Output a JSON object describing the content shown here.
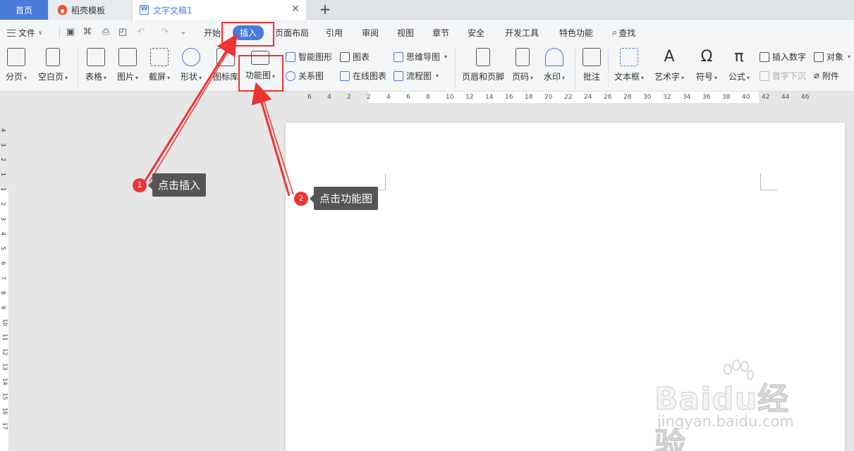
{
  "tabs": {
    "home": "首页",
    "template": "稻壳模板",
    "document": "文字文稿1"
  },
  "menu": {
    "file": "文件",
    "items": [
      "开始",
      "插入",
      "页面布局",
      "引用",
      "审阅",
      "视图",
      "章节",
      "安全",
      "开发工具",
      "特色功能"
    ],
    "active": "插入",
    "search": "查找"
  },
  "ribbon": {
    "page_break": "分页",
    "blank_page": "空白页",
    "table": "表格",
    "picture": "图片",
    "screenshot": "截屏",
    "shape": "形状",
    "icon_library": "图标库",
    "function_chart": "功能图",
    "smart_shape": "智能图形",
    "chart": "图表",
    "mind_map": "思维导图",
    "relation_chart": "关系图",
    "online_chart": "在线图表",
    "flow_chart": "流程图",
    "header_footer": "页眉和页脚",
    "page_number": "页码",
    "watermark": "水印",
    "comment": "批注",
    "text_box": "文本框",
    "word_art": "艺术字",
    "symbol": "符号",
    "formula": "公式",
    "insert_number": "插入数字",
    "object": "对象",
    "drop_cap": "首字下沉",
    "attachment": "附件"
  },
  "ruler": {
    "h_ticks": [
      "6",
      "4",
      "2",
      "2",
      "4",
      "6",
      "8",
      "10",
      "12",
      "14",
      "16",
      "18",
      "20",
      "22",
      "24",
      "26",
      "28",
      "30",
      "32",
      "34",
      "36",
      "38",
      "40",
      "42",
      "44",
      "46"
    ],
    "v_ticks": [
      "4",
      "3",
      "2",
      "1",
      "1",
      "2",
      "3",
      "4",
      "5",
      "6",
      "7",
      "8",
      "9",
      "10",
      "11",
      "12",
      "13",
      "14",
      "15",
      "16",
      "17"
    ]
  },
  "annotations": {
    "step1_num": "1",
    "step1_text": "点击插入",
    "step2_num": "2",
    "step2_text": "点击功能图",
    "color": "#e33333"
  },
  "watermark": {
    "brand": "Baidu经验",
    "url": "jingyan.baidu.com"
  },
  "colors": {
    "accent": "#4a7bd9",
    "highlight": "#e33333"
  }
}
